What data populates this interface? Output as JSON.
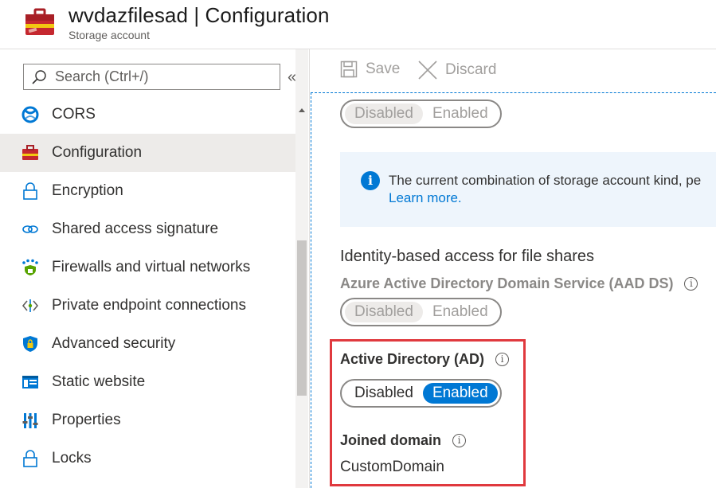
{
  "header": {
    "title": "wvdazfilesad | Configuration",
    "subtitle": "Storage account"
  },
  "sidebar": {
    "search_placeholder": "Search (Ctrl+/)",
    "collapse_glyph": "«",
    "items": [
      {
        "label": "CORS",
        "icon": "cors-icon"
      },
      {
        "label": "Configuration",
        "icon": "briefcase-icon",
        "active": true
      },
      {
        "label": "Encryption",
        "icon": "lock-icon"
      },
      {
        "label": "Shared access signature",
        "icon": "link-icon"
      },
      {
        "label": "Firewalls and virtual networks",
        "icon": "firewall-icon"
      },
      {
        "label": "Private endpoint connections",
        "icon": "endpoint-icon"
      },
      {
        "label": "Advanced security",
        "icon": "shield-icon"
      },
      {
        "label": "Static website",
        "icon": "website-icon"
      },
      {
        "label": "Properties",
        "icon": "properties-icon"
      },
      {
        "label": "Locks",
        "icon": "lock-icon"
      }
    ]
  },
  "toolbar": {
    "save_label": "Save",
    "discard_label": "Discard"
  },
  "main": {
    "top_toggle": {
      "off": "Disabled",
      "on": "Enabled",
      "selected": "Disabled"
    },
    "info": {
      "message": "The current combination of storage account kind, pe",
      "link": "Learn more."
    },
    "identity_section_title": "Identity-based access for file shares",
    "aadds": {
      "label": "Azure Active Directory Domain Service (AAD DS)",
      "toggle": {
        "off": "Disabled",
        "on": "Enabled",
        "selected": "Disabled"
      }
    },
    "ad": {
      "label": "Active Directory (AD)",
      "toggle": {
        "off": "Disabled",
        "on": "Enabled",
        "selected": "Enabled"
      }
    },
    "joined_domain": {
      "label": "Joined domain",
      "value": "CustomDomain"
    },
    "info_glyph": "i"
  },
  "colors": {
    "accent": "#0078d4",
    "highlight": "#e0393e"
  }
}
